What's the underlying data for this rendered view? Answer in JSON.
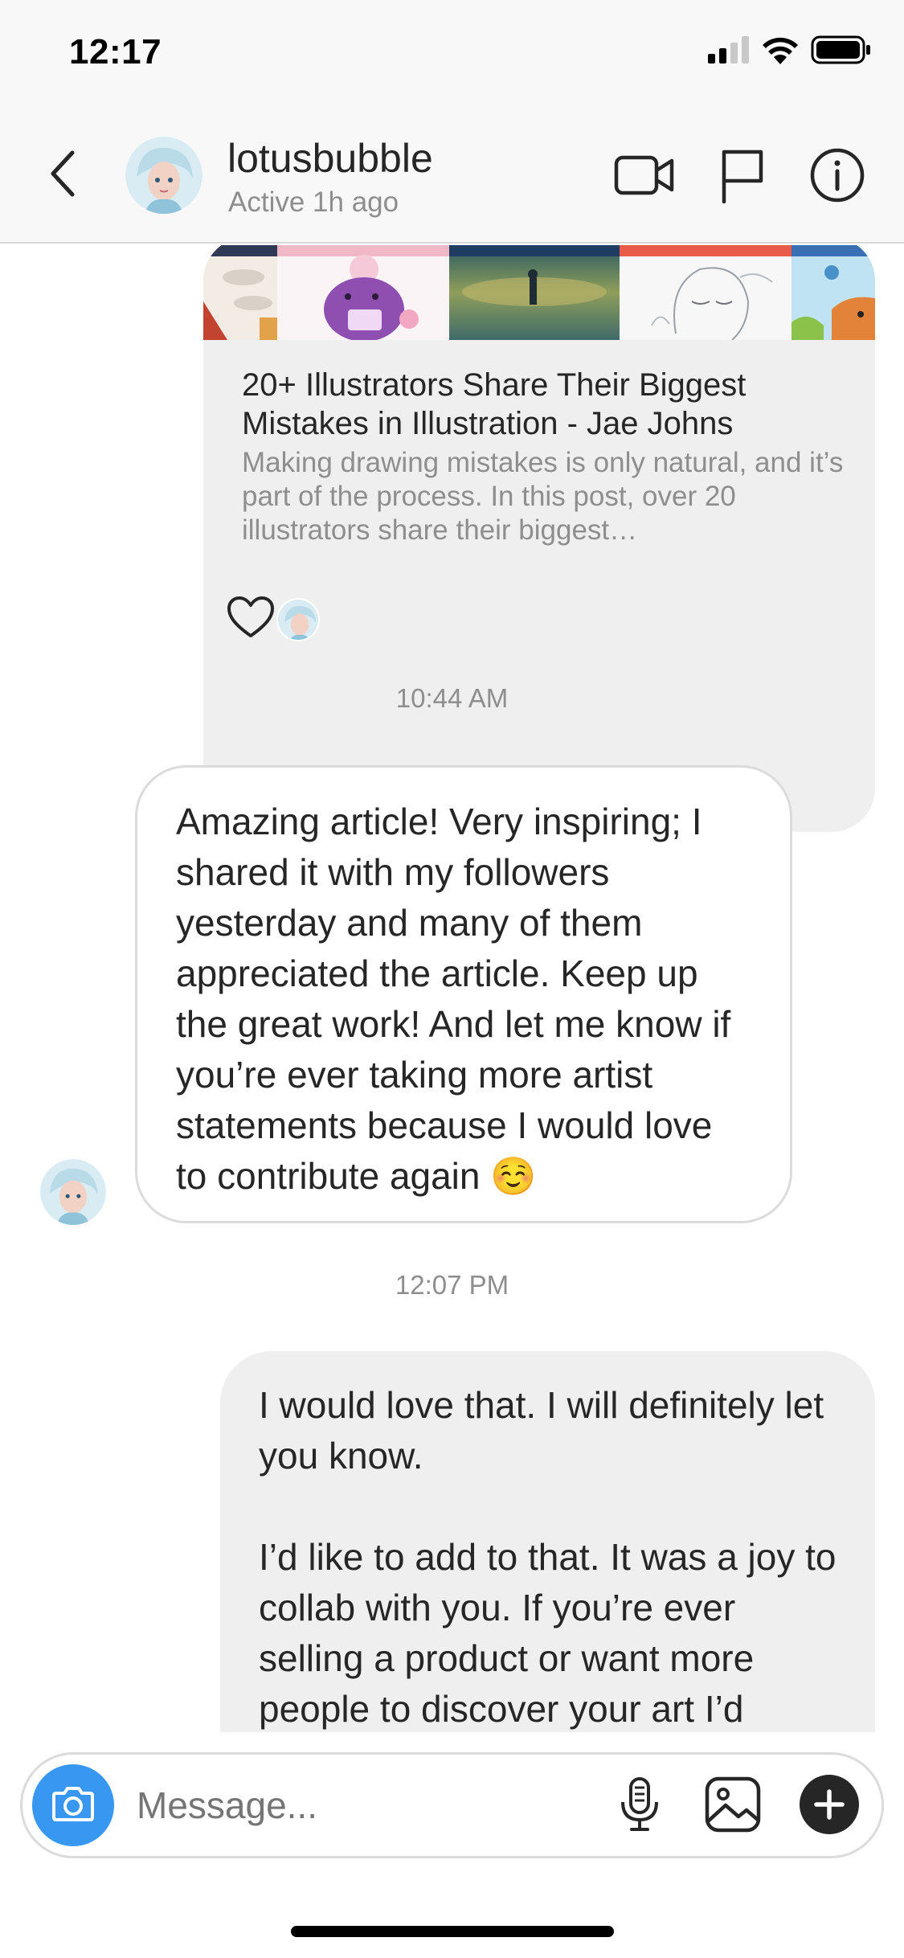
{
  "status_bar": {
    "time": "12:17",
    "icons": [
      "cellular-signal-icon",
      "wifi-icon",
      "battery-icon"
    ]
  },
  "header": {
    "username": "lotusbubble",
    "activity": "Active 1h ago",
    "icons": [
      "back-chevron-icon",
      "video-call-icon",
      "report-flag-icon",
      "info-icon"
    ]
  },
  "messages": {
    "shared_link": {
      "title": "20+ Illustrators Share Their Biggest Mistakes in Illustration - Jae Johns",
      "description": "Making drawing mistakes is only natural, and it’s part of the process. In this post, over 20 illustrators share their biggest…"
    },
    "timestamp_1": "10:44 AM",
    "received": {
      "text": "Amazing article! Very inspiring; I shared it with my followers yesterday and many of them appreciated the article. Keep up the great work! And let me know if you’re ever taking more artist statements because I would love to contribute again ☺️"
    },
    "timestamp_2": "12:07 PM",
    "sent": {
      "text": "I would love that. I will definitely let you know.\n\nI’d like to add to that. It was a joy to collab with you. If you’re ever selling a product or want more people to discover your art I’d"
    }
  },
  "composer": {
    "placeholder": "Message...",
    "icons": [
      "camera-icon",
      "microphone-icon",
      "gallery-icon",
      "plus-icon"
    ]
  },
  "colors": {
    "accent_blue": "#3897f0",
    "bubble_gray": "#efefef",
    "border_gray": "#dbdbdb",
    "secondary_text": "#8e8e8e"
  }
}
